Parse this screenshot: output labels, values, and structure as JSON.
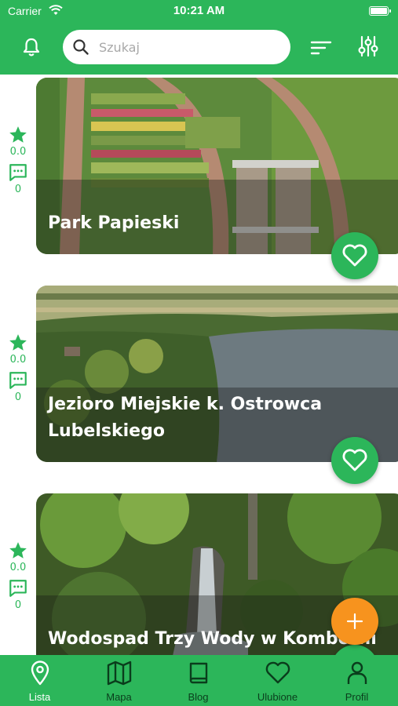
{
  "status_bar": {
    "carrier": "Carrier",
    "time": "10:21 AM"
  },
  "search": {
    "placeholder": "Szukaj",
    "value": ""
  },
  "icons": {
    "notifications": "bell-icon",
    "search": "search-icon",
    "sort": "sort-icon",
    "filter": "sliders-icon"
  },
  "places": [
    {
      "title": "Park Papieski",
      "rating": "0.0",
      "comments": "0",
      "favorite": false
    },
    {
      "title": "Jezioro Miejskie k. Ostrowca Lubelskiego",
      "rating": "0.0",
      "comments": "0",
      "favorite": false
    },
    {
      "title": "Wodospad Trzy Wody w Komborni",
      "rating": "0.0",
      "comments": "0",
      "favorite": false
    }
  ],
  "fab": {
    "icon": "plus-icon"
  },
  "bottom_nav": [
    {
      "label": "Lista",
      "icon": "map-pin-icon",
      "active": true
    },
    {
      "label": "Mapa",
      "icon": "map-icon",
      "active": false
    },
    {
      "label": "Blog",
      "icon": "book-icon",
      "active": false
    },
    {
      "label": "Ulubione",
      "icon": "heart-icon",
      "active": false
    },
    {
      "label": "Profil",
      "icon": "user-icon",
      "active": false
    }
  ],
  "colors": {
    "primary": "#2cb65a",
    "accent": "#f7931e",
    "nav_inactive": "#0a3d1c",
    "nav_active": "#ffffff"
  }
}
